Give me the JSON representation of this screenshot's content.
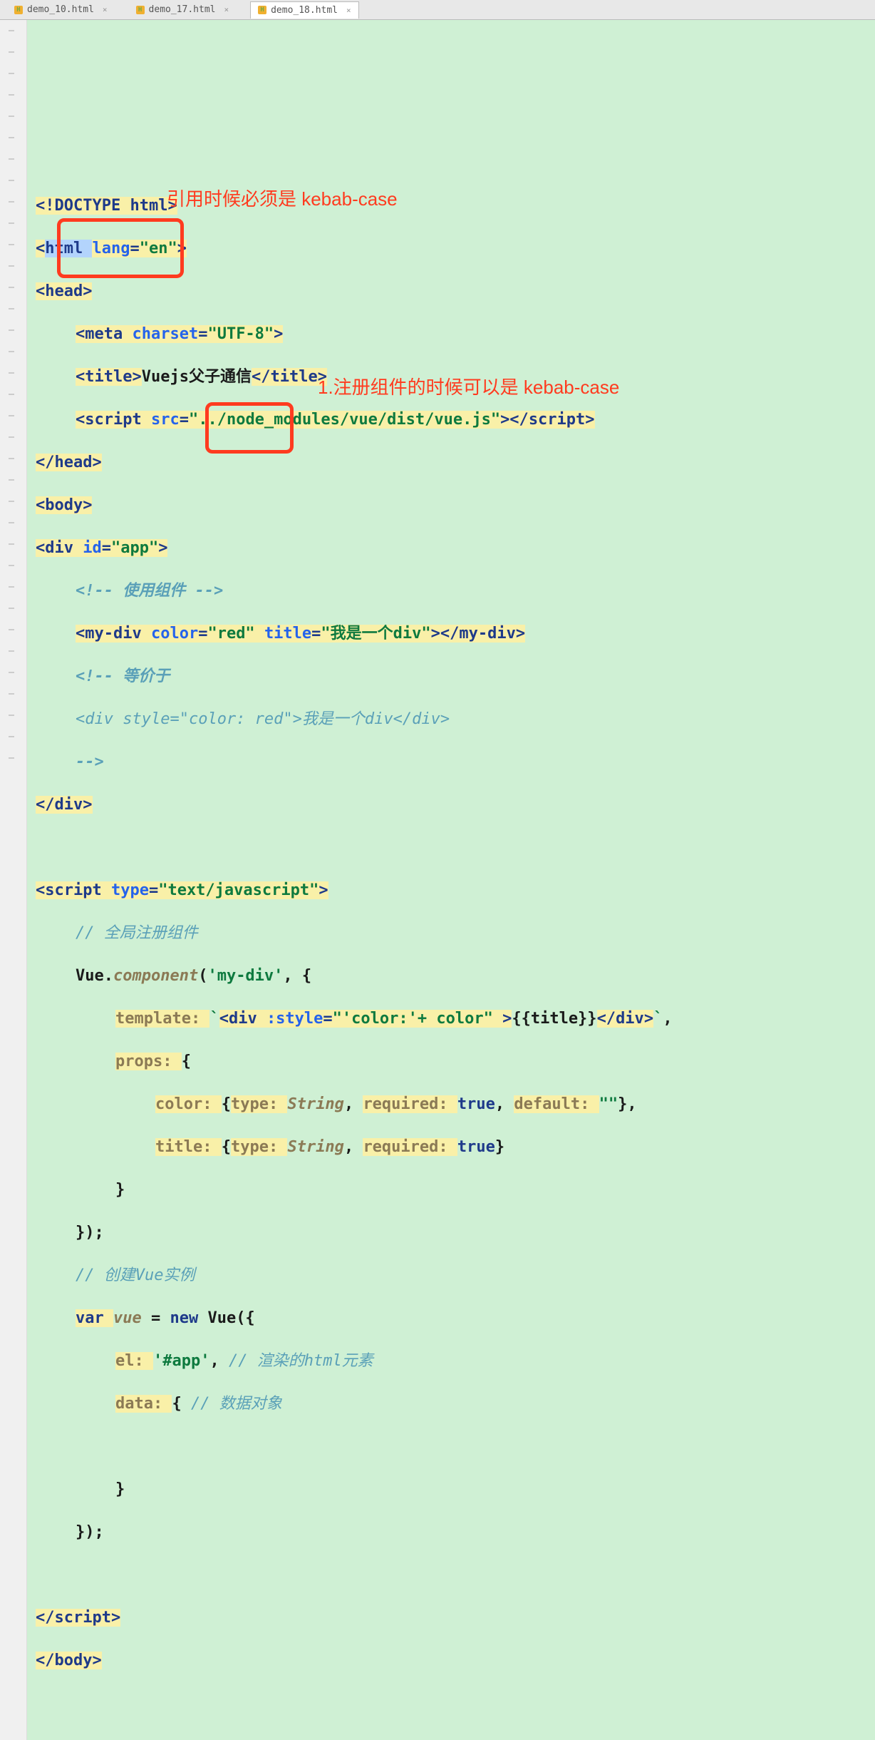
{
  "tabs": {
    "t1": "demo_10.html",
    "t2": "demo_17.html",
    "t3": "demo_18.html"
  },
  "annotations": {
    "top": "引用时候必须是 kebab-case",
    "right": "1.注册组件的时候可以是 kebab-case"
  },
  "code": {
    "l1_a": "<!DOCTYPE ",
    "l1_b": "html",
    "l1_c": ">",
    "l2_a": "<",
    "l2_b": "html ",
    "l2_c": "lang",
    "l2_d": "=",
    "l2_e": "\"en\"",
    "l2_f": ">",
    "l3_a": "<",
    "l3_b": "head",
    "l3_c": ">",
    "l4_a": "<",
    "l4_b": "meta ",
    "l4_c": "charset",
    "l4_d": "=",
    "l4_e": "\"UTF-8\"",
    "l4_f": ">",
    "l5_a": "<",
    "l5_b": "title",
    "l5_c": ">",
    "l5_d": "Vuejs父子通信",
    "l5_e": "</",
    "l5_f": "title",
    "l5_g": ">",
    "l6_a": "<",
    "l6_b": "script ",
    "l6_c": "src",
    "l6_d": "=",
    "l6_e": "\"../node_modules/vue/dist/vue.js\"",
    "l6_f": "></",
    "l6_g": "script",
    "l6_h": ">",
    "l7_a": "</",
    "l7_b": "head",
    "l7_c": ">",
    "l8_a": "<",
    "l8_b": "body",
    "l8_c": ">",
    "l9_a": "<",
    "l9_b": "div ",
    "l9_c": "id",
    "l9_d": "=",
    "l9_e": "\"app\"",
    "l9_f": ">",
    "l10": "<!-- 使用组件 -->",
    "l11_a": "<",
    "l11_b": "my-div ",
    "l11_c": "color",
    "l11_d": "=",
    "l11_e": "\"red\" ",
    "l11_f": "title",
    "l11_g": "=",
    "l11_h": "\"我是一个div\"",
    "l11_i": "></",
    "l11_j": "my-div",
    "l11_k": ">",
    "l12": "<!-- 等价于",
    "l13_a": "<div ",
    "l13_b": "style",
    "l13_c": "=",
    "l13_d": "\"color: red\"",
    "l13_e": ">我是一个div</div>",
    "l14": "-->",
    "l15_a": "</",
    "l15_b": "div",
    "l15_c": ">",
    "l16": "",
    "l17_a": "<",
    "l17_b": "script ",
    "l17_c": "type",
    "l17_d": "=",
    "l17_e": "\"text/javascript\"",
    "l17_f": ">",
    "l18": "// 全局注册组件",
    "l19_a": "Vue.",
    "l19_b": "component",
    "l19_c": "(",
    "l19_d": "'my-div'",
    "l19_e": ", {",
    "l20_a": "template: ",
    "l20_b": "`",
    "l20_c": "<",
    "l20_d": "div ",
    "l20_e": ":style",
    "l20_f": "=",
    "l20_g": "\"'color:'+ color\" ",
    "l20_h": ">",
    "l20_i": "{{title}}",
    "l20_j": "</",
    "l20_k": "div",
    "l20_l": ">",
    "l20_m": "`",
    "l20_n": ",",
    "l21_a": "props: ",
    "l21_b": "{",
    "l22_a": "color: ",
    "l22_b": "{",
    "l22_c": "type: ",
    "l22_d": "String",
    "l22_e": ", ",
    "l22_f": "required: ",
    "l22_g": "true",
    "l22_h": ", ",
    "l22_i": "default: ",
    "l22_j": "\"\"",
    "l22_k": "},",
    "l23_a": "title: ",
    "l23_b": "{",
    "l23_c": "type: ",
    "l23_d": "String",
    "l23_e": ", ",
    "l23_f": "required: ",
    "l23_g": "true",
    "l23_h": "}",
    "l24": "}",
    "l25": "});",
    "l26": "// 创建Vue实例",
    "l27_a": "var ",
    "l27_b": "vue ",
    "l27_c": "= ",
    "l27_d": "new ",
    "l27_e": "Vue({",
    "l28_a": "el: ",
    "l28_b": "'#app'",
    "l28_c": ", ",
    "l28_d": "// 渲染的html元素",
    "l29_a": "data: ",
    "l29_b": "{ ",
    "l29_c": "// 数据对象",
    "l30": "",
    "l31": "}",
    "l32": "});",
    "l33": "",
    "l34_a": "</",
    "l34_b": "script",
    "l34_c": ">",
    "l35_a": "</",
    "l35_b": "body",
    "l35_c": ">"
  }
}
